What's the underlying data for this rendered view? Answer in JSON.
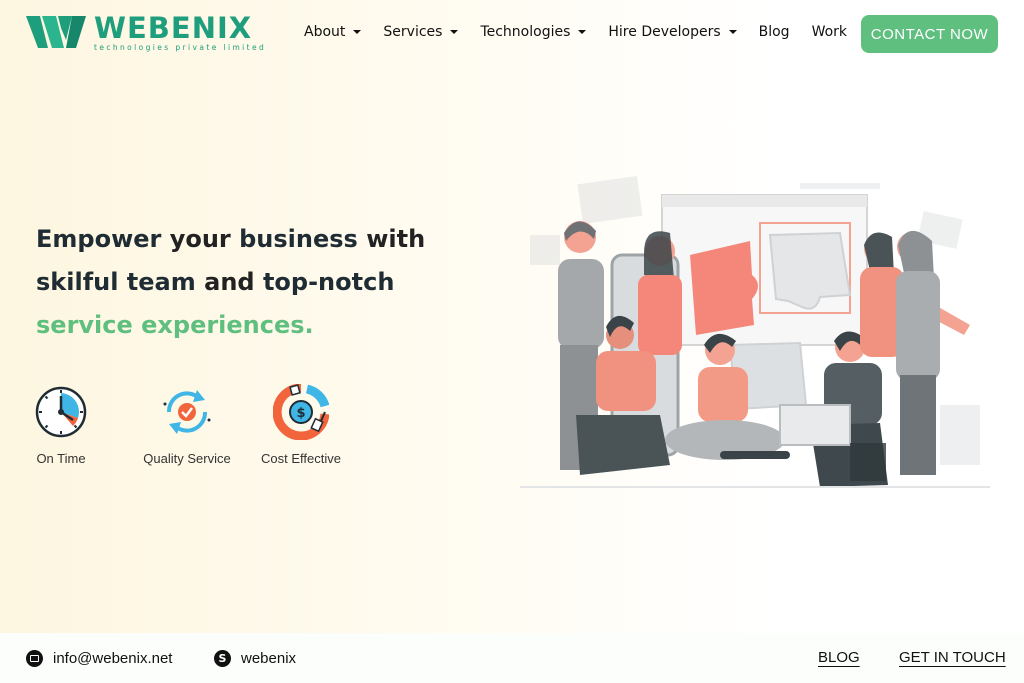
{
  "brand": {
    "name": "WEBENIX",
    "tagline": "technologies private limited",
    "color": "#1e9e7c"
  },
  "nav": {
    "items": [
      {
        "label": "About",
        "dropdown": true
      },
      {
        "label": "Services",
        "dropdown": true
      },
      {
        "label": "Technologies",
        "dropdown": true
      },
      {
        "label": "Hire Developers",
        "dropdown": true
      },
      {
        "label": "Blog",
        "dropdown": false
      },
      {
        "label": "Work",
        "dropdown": false
      }
    ],
    "cta_label": "CONTACT NOW",
    "cta_color": "#5fbf7f"
  },
  "hero": {
    "line1": {
      "a": "Empower",
      "b": " your ",
      "c": "business",
      "d": " with"
    },
    "line2": {
      "a": "skilful team",
      "b": " and ",
      "c": "top-notch"
    },
    "line3": "service experiences.",
    "accent_color": "#5fbf7f"
  },
  "features": [
    {
      "icon": "clock-icon",
      "label": "On Time"
    },
    {
      "icon": "quality-cycle-icon",
      "label": "Quality Service"
    },
    {
      "icon": "cost-dollar-icon",
      "label": "Cost Effective"
    }
  ],
  "illustration": {
    "icon": "team-puzzle-illustration"
  },
  "bottom_bar": {
    "email": "info@webenix.net",
    "skype": "webenix",
    "blog_label": "BLOG",
    "get_in_touch_label": "GET IN TOUCH"
  }
}
